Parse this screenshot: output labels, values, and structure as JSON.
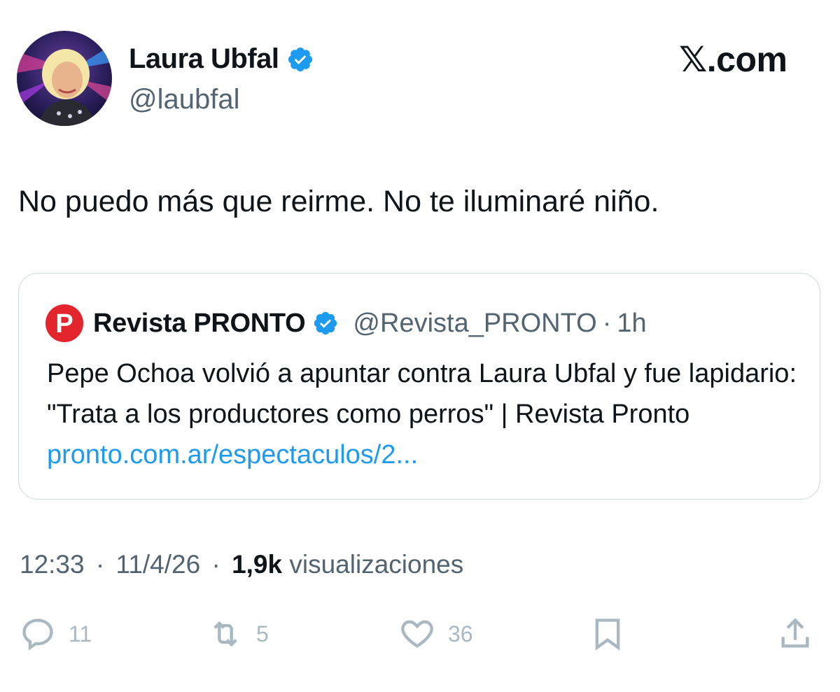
{
  "author": {
    "name": "Laura Ubfal",
    "handle": "@laubfal",
    "verified": true
  },
  "brand": "𝕏.com",
  "tweet": {
    "text": "No puedo más que reirme. No te iluminaré niño."
  },
  "quote": {
    "name": "Revista PRONTO",
    "handle": "@Revista_PRONTO",
    "separator": "·",
    "time": "1h",
    "verified": true,
    "logo_letter": "P",
    "text": "Pepe Ochoa volvió a apuntar contra Laura Ubfal y fue lapidario: \"Trata a los productores como perros\" | Revista Pronto",
    "link": "pronto.com.ar/espectaculos/2..."
  },
  "meta": {
    "time": "12:33",
    "date": "11/4/26",
    "separator": "·",
    "views_count": "1,9k",
    "views_label": "visualizaciones"
  },
  "actions": {
    "replies": "11",
    "reposts": "5",
    "likes": "36"
  },
  "icons": {
    "verified": "verified-badge-icon",
    "reply": "reply-icon",
    "repost": "repost-icon",
    "like": "heart-icon",
    "bookmark": "bookmark-icon",
    "share": "share-icon"
  },
  "colors": {
    "verified": "#1d9bf0",
    "link": "#1d9bf0",
    "secondary_text": "#536471",
    "action_icons": "#aab8c2",
    "pronto_logo": "#e3262d"
  }
}
